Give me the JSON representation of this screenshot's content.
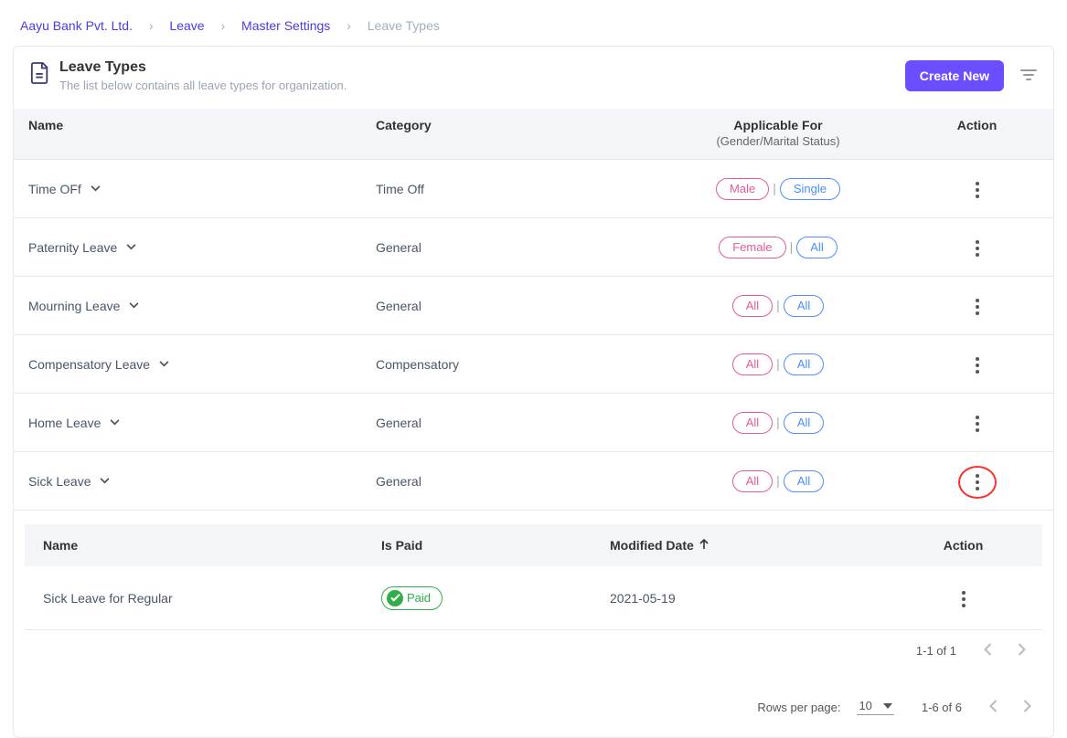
{
  "breadcrumb": {
    "items": [
      "Aayu Bank Pvt. Ltd.",
      "Leave",
      "Master Settings"
    ],
    "current": "Leave Types"
  },
  "header": {
    "title": "Leave Types",
    "subtitle": "The list below contains all leave types for organization.",
    "create_label": "Create New"
  },
  "columns": {
    "name": "Name",
    "category": "Category",
    "applicable": "Applicable For",
    "applicable_sub": "(Gender/Marital Status)",
    "action": "Action"
  },
  "rows": [
    {
      "name": "Time OFf",
      "category": "Time Off",
      "gender": "Male",
      "marital": "Single",
      "expanded": false,
      "highlight": false
    },
    {
      "name": "Paternity Leave",
      "category": "General",
      "gender": "Female",
      "marital": "All",
      "expanded": false,
      "highlight": false
    },
    {
      "name": "Mourning Leave",
      "category": "General",
      "gender": "All",
      "marital": "All",
      "expanded": false,
      "highlight": false
    },
    {
      "name": "Compensatory Leave",
      "category": "Compensatory",
      "gender": "All",
      "marital": "All",
      "expanded": false,
      "highlight": false
    },
    {
      "name": "Home Leave",
      "category": "General",
      "gender": "All",
      "marital": "All",
      "expanded": false,
      "highlight": false
    },
    {
      "name": "Sick Leave",
      "category": "General",
      "gender": "All",
      "marital": "All",
      "expanded": true,
      "highlight": true
    }
  ],
  "sub": {
    "columns": {
      "name": "Name",
      "is_paid": "Is Paid",
      "modified": "Modified Date",
      "action": "Action"
    },
    "rows": [
      {
        "name": "Sick Leave for Regular",
        "paid_label": "Paid",
        "modified": "2021-05-19"
      }
    ],
    "range": "1-1 of 1"
  },
  "pagination": {
    "rpp_label": "Rows per page:",
    "rpp_value": "10",
    "range": "1-6 of 6"
  }
}
